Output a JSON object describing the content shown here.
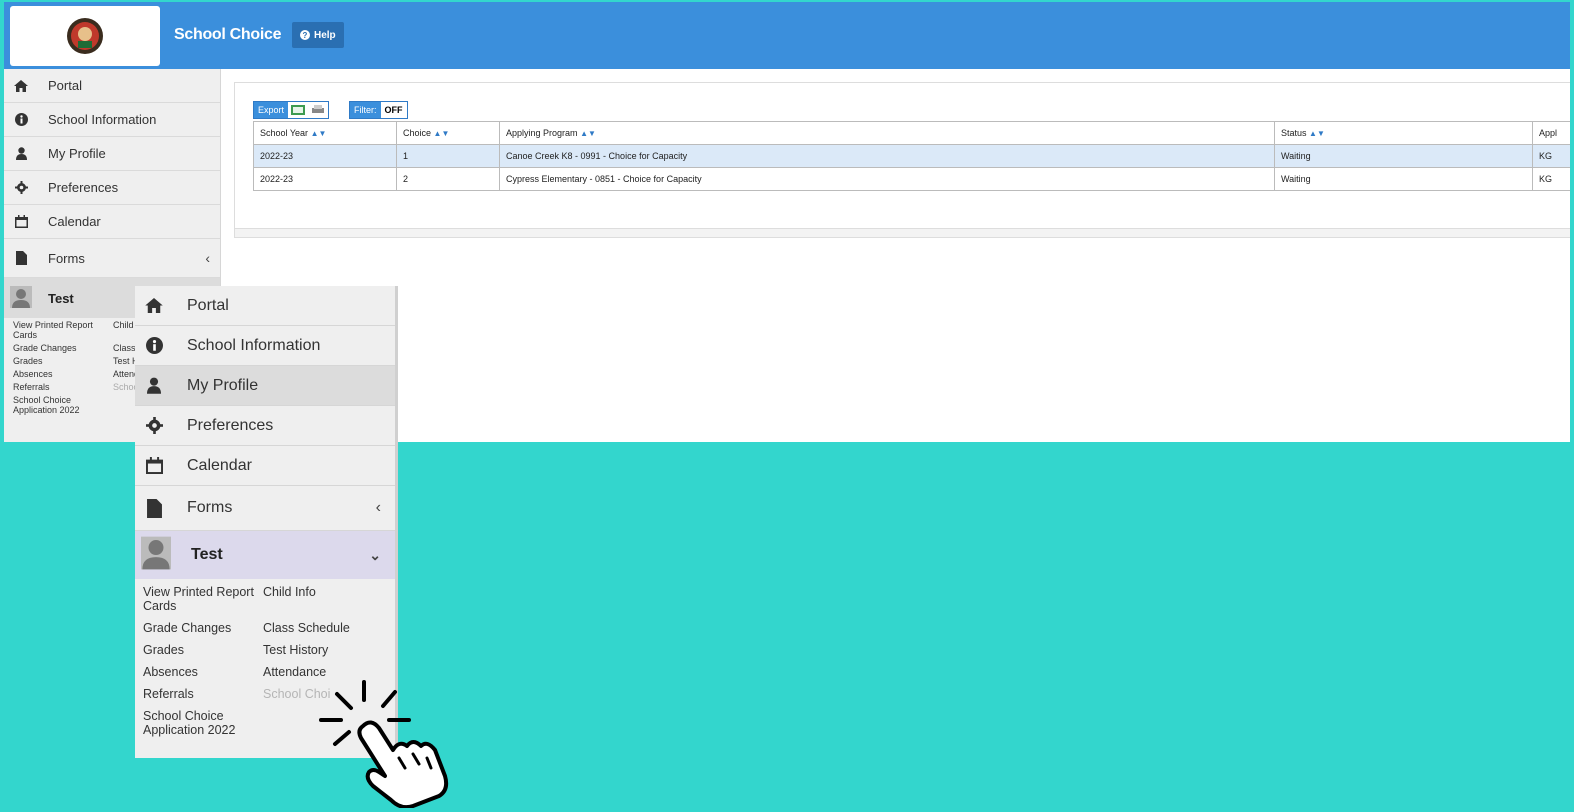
{
  "header": {
    "app_title": "School Choice",
    "help_label": "Help",
    "brand_color": "#3b8fdc"
  },
  "sidebar": {
    "items": [
      {
        "label": "Portal",
        "icon": "home-icon"
      },
      {
        "label": "School Information",
        "icon": "info-icon"
      },
      {
        "label": "My Profile",
        "icon": "user-icon"
      },
      {
        "label": "Preferences",
        "icon": "gear-icon"
      },
      {
        "label": "Calendar",
        "icon": "calendar-icon"
      },
      {
        "label": "Forms",
        "icon": "document-icon"
      }
    ],
    "user_name": "Test",
    "sublinks": [
      {
        "label": "View Printed Report Cards"
      },
      {
        "label": "Child Info"
      },
      {
        "label": "Grade Changes"
      },
      {
        "label": "Class Schedule"
      },
      {
        "label": "Grades"
      },
      {
        "label": "Test History"
      },
      {
        "label": "Absences"
      },
      {
        "label": "Attendance"
      },
      {
        "label": "Referrals"
      },
      {
        "label": "School Choice"
      },
      {
        "label": "School Choice Application 2022"
      }
    ]
  },
  "toolbar": {
    "export_label": "Export",
    "filter_label": "Filter:",
    "filter_value": "OFF"
  },
  "table": {
    "columns": [
      "School Year",
      "Choice",
      "Applying Program",
      "Status",
      "Appl"
    ],
    "rows": [
      [
        "2022-23",
        "1",
        "Canoe Creek K8 - 0991 - Choice for Capacity",
        "Waiting",
        "KG"
      ],
      [
        "2022-23",
        "2",
        "Cypress Elementary - 0851 - Choice for Capacity",
        "Waiting",
        "KG"
      ]
    ]
  },
  "zoom": {
    "active_item": "My Profile",
    "school_choice_partial": "School Choi"
  }
}
